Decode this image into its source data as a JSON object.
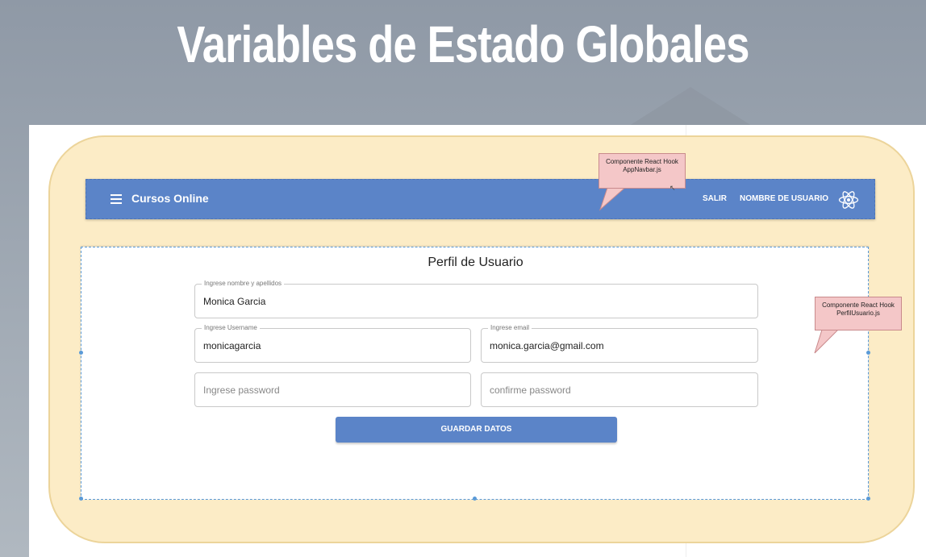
{
  "slide": {
    "title": "Variables de Estado Globales"
  },
  "navbar": {
    "brand": "Cursos Online",
    "salir": "SALIR",
    "usuario": "NOMBRE DE USUARIO",
    "menu_icon": "hamburger-menu-icon",
    "react_icon": "react-logo-icon",
    "color": "#5b84c8"
  },
  "callouts": {
    "navbar_line1": "Componente React Hook",
    "navbar_line2": "AppNavbar.js",
    "perfil_line1": "Componente React Hook",
    "perfil_line2": "PerfilUsuario.js"
  },
  "perfil": {
    "title": "Perfil de Usuario",
    "nombre_label": "Ingrese nombre y apellidos",
    "nombre_value": "Monica Garcia",
    "username_label": "Ingrese Username",
    "username_value": "monicagarcia",
    "email_label": "Ingrese email",
    "email_value": "monica.garcia@gmail.com",
    "password_placeholder": "Ingrese password",
    "confirm_placeholder": "confirme password",
    "save_label": "GUARDAR DATOS"
  }
}
